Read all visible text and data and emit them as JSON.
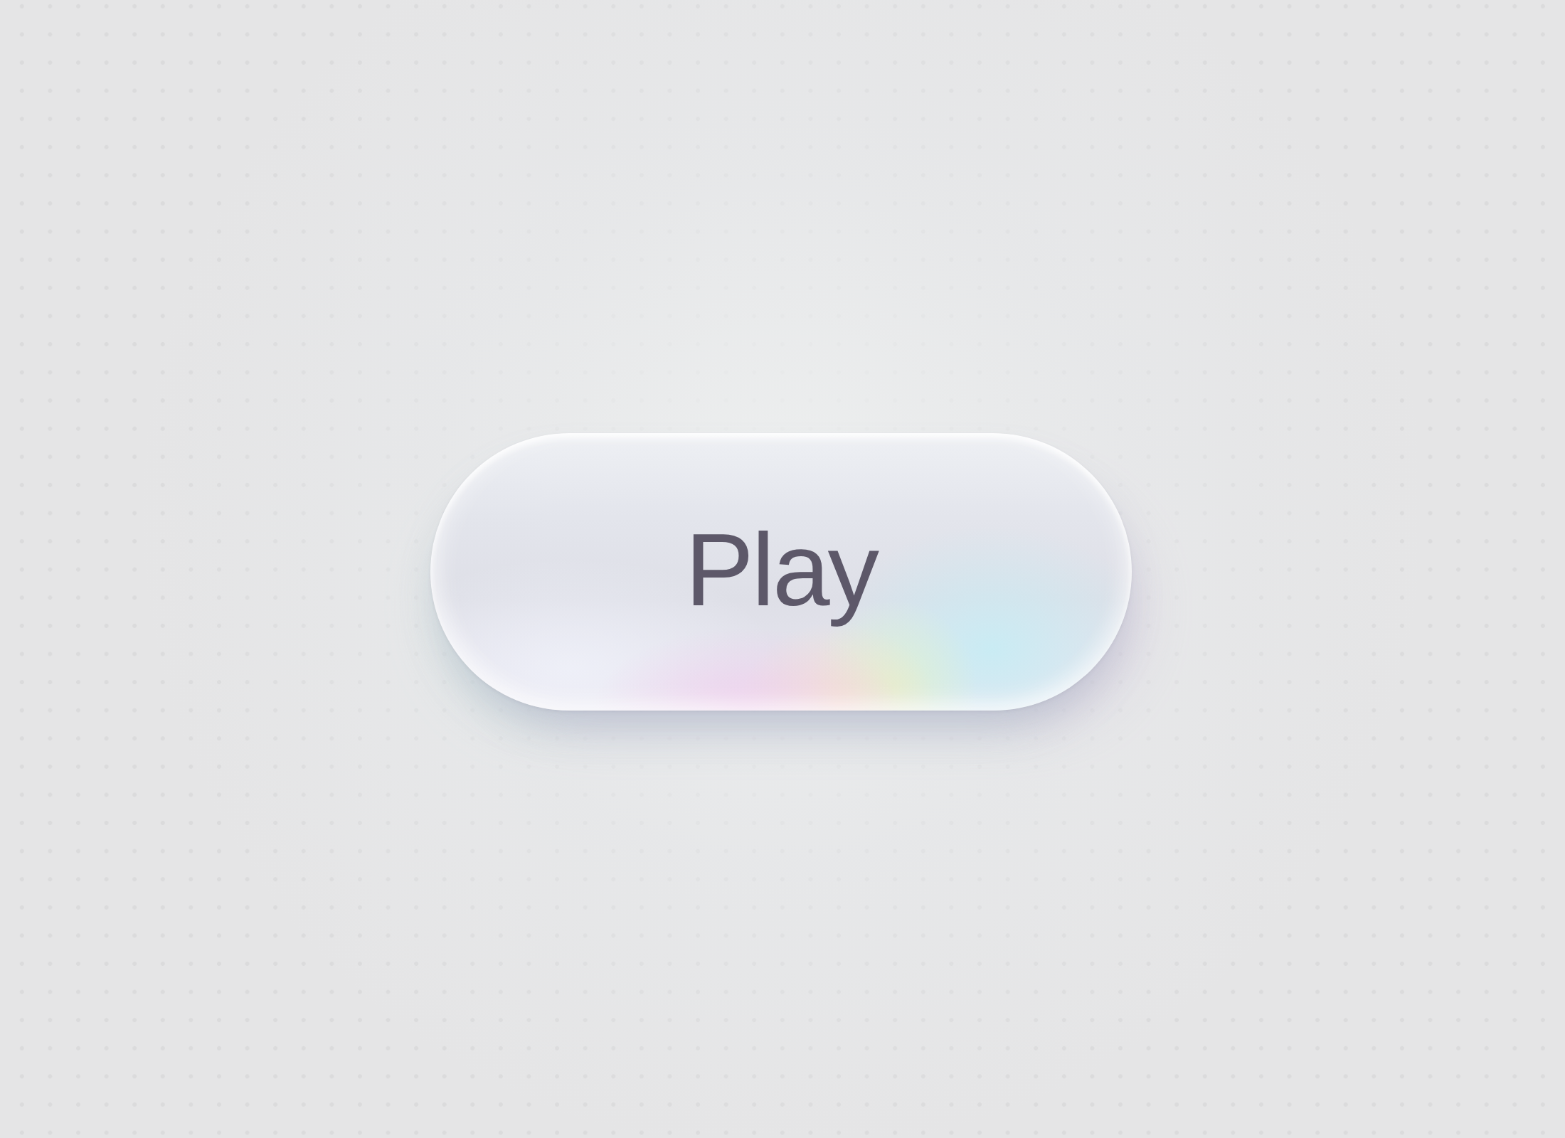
{
  "button": {
    "label": "Play"
  }
}
